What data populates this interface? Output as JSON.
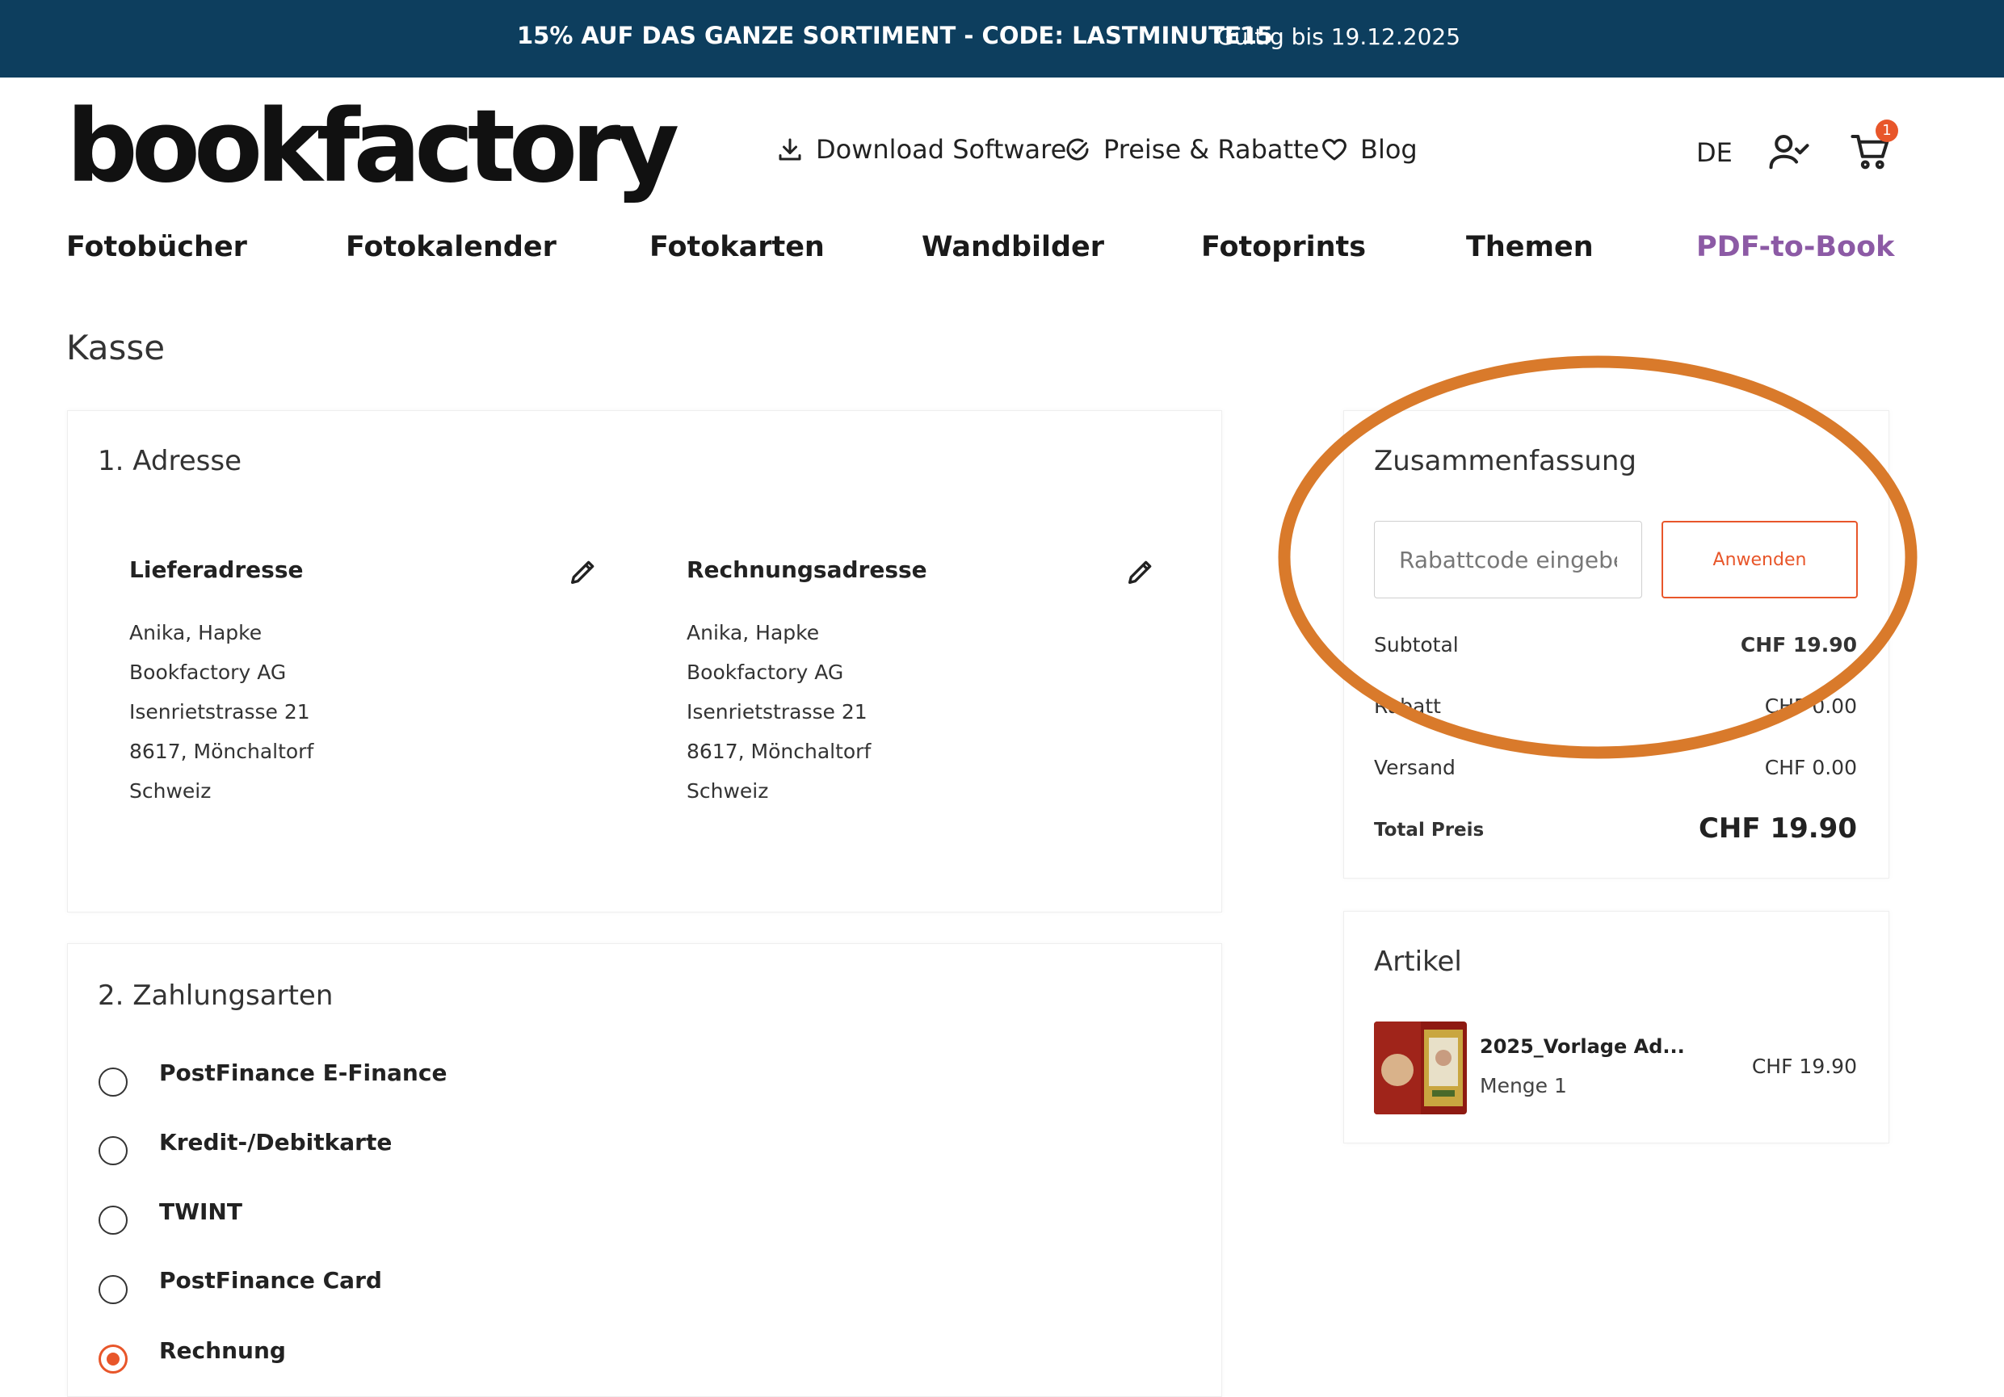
{
  "promo": {
    "text": "15% AUF DAS GANZE SORTIMENT - CODE: LASTMINUTE15",
    "valid": "Gültig bis 19.12.2025"
  },
  "header": {
    "logo": "bookfactory",
    "links": {
      "download": {
        "label": "Download Software",
        "icon": "download-icon"
      },
      "prices": {
        "label": "Preise & Rabatte",
        "icon": "check-circle-icon"
      },
      "blog": {
        "label": "Blog",
        "icon": "heart-icon"
      }
    },
    "language": "DE",
    "cart_count": "1"
  },
  "nav": {
    "fotobuecher": "Fotobücher",
    "fotokalender": "Fotokalender",
    "fotokarten": "Fotokarten",
    "wandbilder": "Wandbilder",
    "fotoprints": "Fotoprints",
    "themen": "Themen",
    "pdf_to_book": "PDF-to-Book"
  },
  "page_title": "Kasse",
  "address": {
    "heading": "1. Adresse",
    "shipping": {
      "title": "Lieferadresse",
      "lines": [
        "Anika, Hapke",
        "Bookfactory AG",
        "Isenrietstrasse 21",
        "8617, Mönchaltorf",
        "Schweiz"
      ]
    },
    "billing": {
      "title": "Rechnungsadresse",
      "lines": [
        "Anika, Hapke",
        "Bookfactory AG",
        "Isenrietstrasse 21",
        "8617, Mönchaltorf",
        "Schweiz"
      ]
    }
  },
  "payment": {
    "heading": "2. Zahlungsarten",
    "options": [
      {
        "label": "PostFinance E-Finance",
        "selected": false
      },
      {
        "label": "Kredit-/Debitkarte",
        "selected": false
      },
      {
        "label": "TWINT",
        "selected": false
      },
      {
        "label": "PostFinance Card",
        "selected": false
      },
      {
        "label": "Rechnung",
        "selected": true
      }
    ]
  },
  "summary": {
    "heading": "Zusammenfassung",
    "discount_placeholder": "Rabattcode eingeben",
    "apply_label": "Anwenden",
    "subtotal_label": "Subtotal",
    "subtotal_value": "CHF 19.90",
    "rabatt_label": "Rabatt",
    "rabatt_value": "CHF 0.00",
    "versand_label": "Versand",
    "versand_value": "CHF 0.00",
    "total_label": "Total Preis",
    "total_value": "CHF 19.90"
  },
  "articles": {
    "heading": "Artikel",
    "items": [
      {
        "name": "2025_Vorlage Ad...",
        "qty": "Menge 1",
        "price": "CHF 19.90"
      }
    ]
  },
  "colors": {
    "promo_bg": "#0d3e5e",
    "accent_orange": "#e8562a",
    "highlight_orange": "#d97a2b",
    "nav_purple": "#8c5aa5"
  }
}
